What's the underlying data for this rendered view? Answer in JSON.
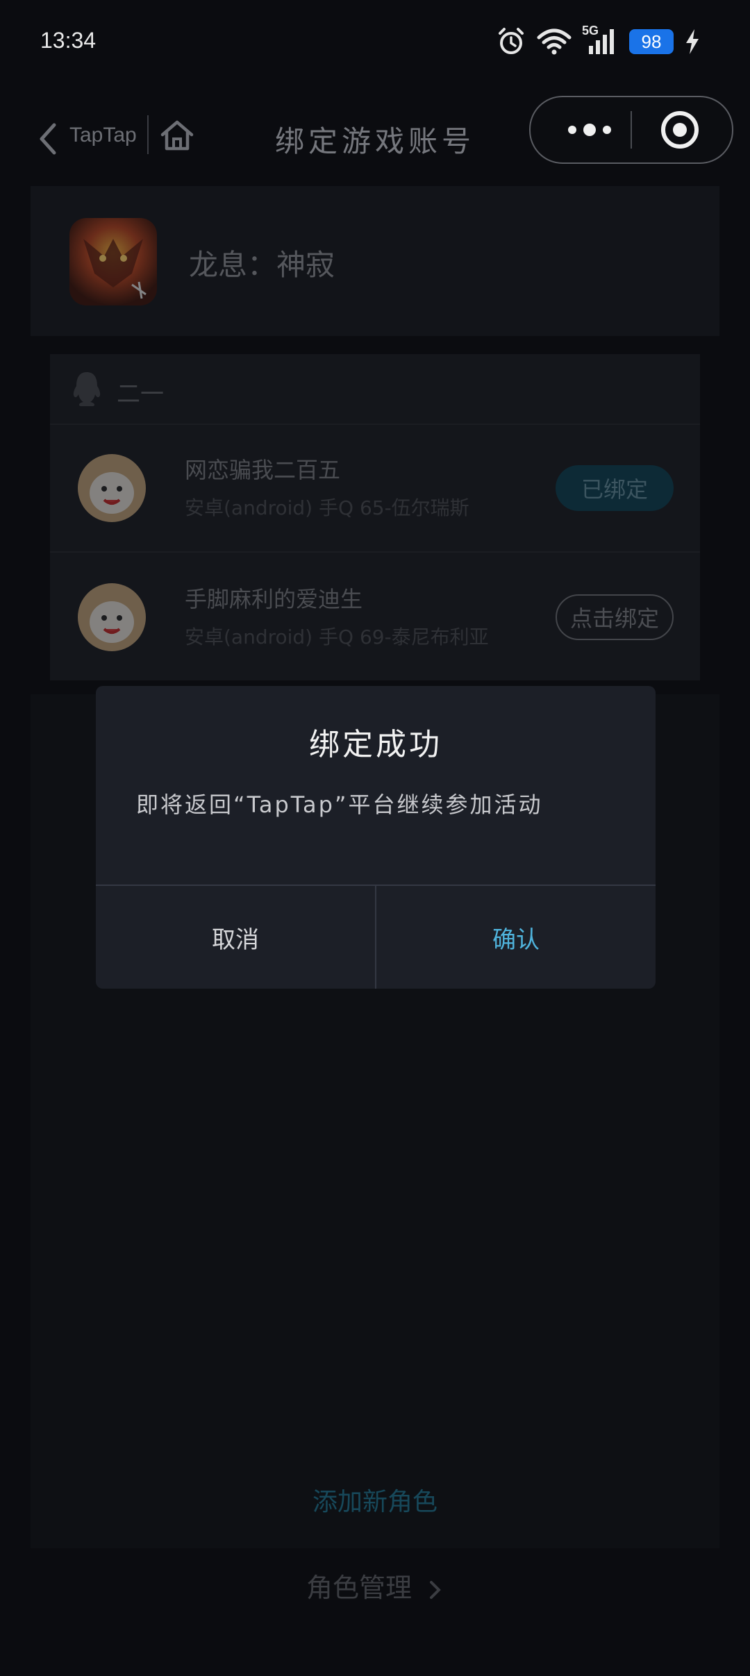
{
  "status_bar": {
    "time": "13:34",
    "network": "5G",
    "battery": "98",
    "icons": [
      "alarm-icon",
      "wifi-icon",
      "signal-icon",
      "battery-icon",
      "charging-icon"
    ]
  },
  "nav": {
    "back_label": "TapTap",
    "title": "绑定游戏账号"
  },
  "game": {
    "name": "龙息：神寂"
  },
  "account": {
    "label": "二一",
    "roles": [
      {
        "name": "网恋骗我二百五",
        "detail": "安卓(android) 手Q 65-伍尔瑞斯",
        "action": "已绑定"
      },
      {
        "name": "手脚麻利的爱迪生",
        "detail": "安卓(android) 手Q 69-泰尼布利亚",
        "action": "点击绑定"
      }
    ]
  },
  "footer": {
    "add_role": "添加新角色",
    "role_manage": "角色管理"
  },
  "dialog": {
    "title": "绑定成功",
    "message": "即将返回“TapTap”平台继续参加活动",
    "cancel": "取消",
    "confirm": "确认"
  },
  "colors": {
    "accent": "#4fb3dc",
    "battery": "#1a73e8",
    "dialog_bg": "#1c1f27",
    "page_bg": "#0b0c10"
  }
}
